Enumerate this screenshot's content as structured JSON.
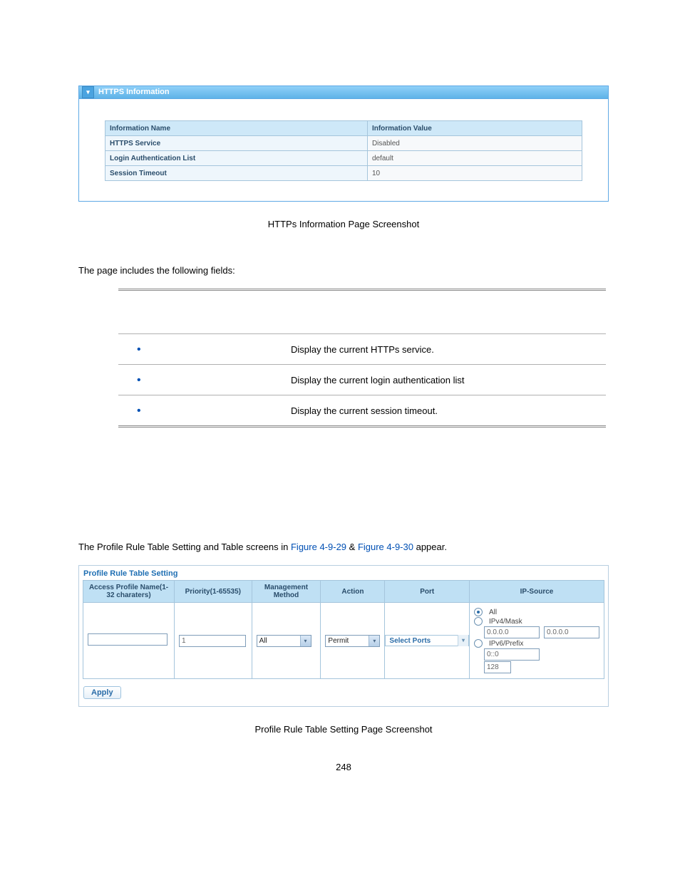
{
  "https_panel": {
    "header_title": "HTTPS Information",
    "col_name": "Information Name",
    "col_value": "Information Value",
    "rows": [
      {
        "name": "HTTPS Service",
        "value": "Disabled"
      },
      {
        "name": "Login Authentication List",
        "value": "default"
      },
      {
        "name": "Session Timeout",
        "value": "10"
      }
    ]
  },
  "caption1": "HTTPs Information Page Screenshot",
  "body_text": "The page includes the following fields:",
  "fields": [
    {
      "desc": "Display the current HTTPs service."
    },
    {
      "desc": "Display the current login authentication list"
    },
    {
      "desc": "Display the current session timeout."
    }
  ],
  "para_profile_prefix": "The Profile Rule Table Setting and Table screens in ",
  "fig1": "Figure 4-9-29",
  "amp": " & ",
  "fig2": "Figure 4-9-30",
  "para_profile_suffix": " appear.",
  "profile_panel": {
    "title": "Profile Rule Table Setting",
    "headers": {
      "name": "Access Profile Name(1-32 charaters)",
      "priority": "Priority(1-65535)",
      "method": "Management Method",
      "action": "Action",
      "port": "Port",
      "ip": "IP-Source"
    },
    "row": {
      "name_value": "",
      "priority_value": "1",
      "method_value": "All",
      "action_value": "Permit",
      "port_value": "Select Ports",
      "ip": {
        "opt_all": "All",
        "opt_v4": "IPv4/Mask",
        "v4_addr": "0.0.0.0",
        "v4_mask": "0.0.0.0",
        "opt_v6": "IPv6/Prefix",
        "v6_addr": "0::0",
        "v6_prefix": "128"
      }
    },
    "apply": "Apply"
  },
  "caption2": "Profile Rule Table Setting Page Screenshot",
  "pagenum": "248"
}
